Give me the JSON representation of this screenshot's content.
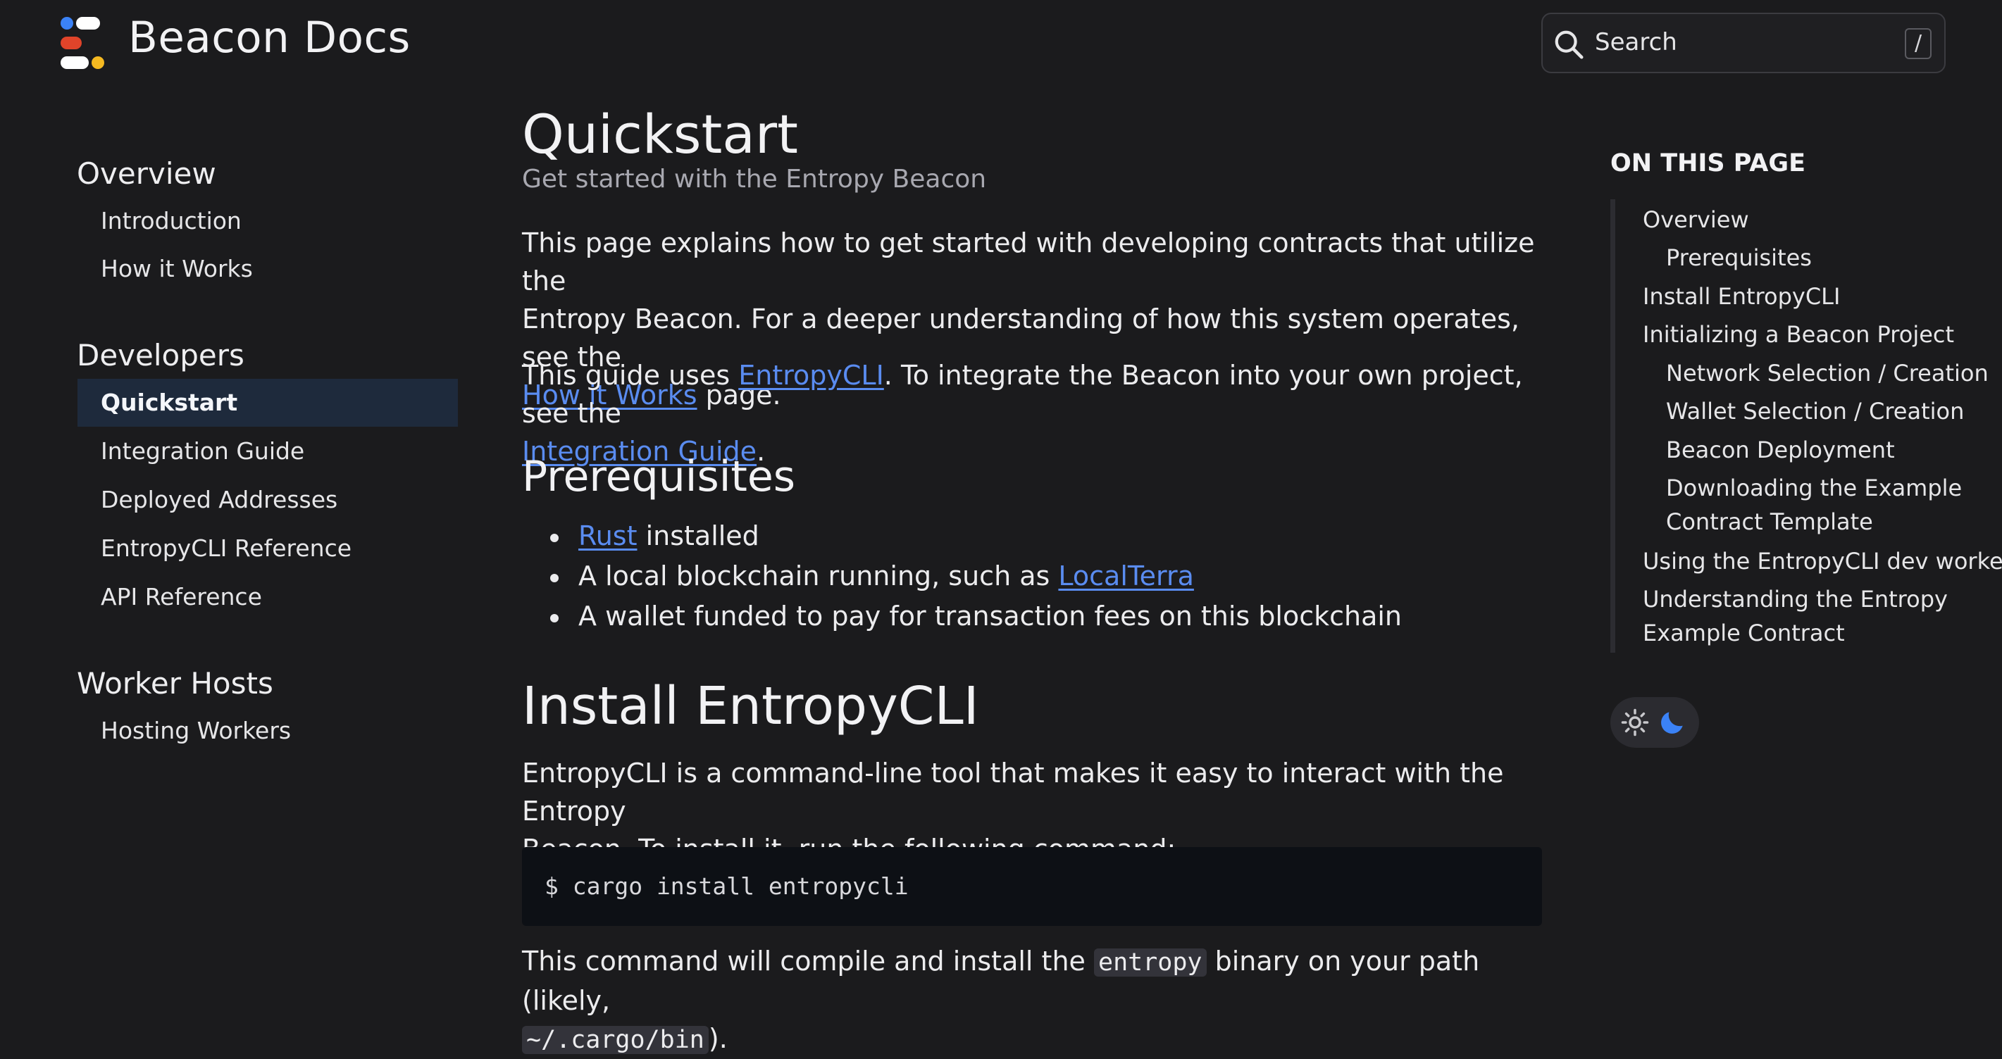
{
  "header": {
    "brand": "Beacon Docs",
    "search_placeholder": "Search",
    "search_shortcut": "/"
  },
  "colors": {
    "background": "#1b1b1d",
    "link": "#5a8cf0",
    "active_bg": "#1e2a3c",
    "logo_blue": "#3b82f6",
    "logo_red": "#e0442a",
    "logo_yellow": "#f5b921",
    "logo_white": "#ffffff"
  },
  "sidebar": {
    "sections": [
      {
        "title": "Overview",
        "items": [
          "Introduction",
          "How it Works"
        ]
      },
      {
        "title": "Developers",
        "items": [
          "Quickstart",
          "Integration Guide",
          "Deployed Addresses",
          "EntropyCLI Reference",
          "API Reference"
        ]
      },
      {
        "title": "Worker Hosts",
        "items": [
          "Hosting Workers"
        ]
      }
    ],
    "active_item": "Quickstart"
  },
  "main": {
    "title": "Quickstart",
    "subtitle": "Get started with the Entropy Beacon",
    "intro": {
      "line1": "This page explains how to get started with developing contracts that utilize the",
      "line2": "Entropy Beacon. For a deeper understanding of how this system operates, see the",
      "link": "How it Works",
      "after": " page."
    },
    "guide": {
      "before": "This guide uses ",
      "link1": "EntropyCLI",
      "middle": ". To integrate the Beacon into your own project, see the",
      "link2": "Integration Guide",
      "after": "."
    },
    "prerequisites": {
      "heading": "Prerequisites",
      "b1_link": "Rust",
      "b1_text": " installed",
      "b2_text": "A local blockchain running, such as ",
      "b2_link": "LocalTerra",
      "b3_text": "A wallet funded to pay for transaction fees on this blockchain"
    },
    "install": {
      "heading": "Install EntropyCLI",
      "line1": "EntropyCLI is a command-line tool that makes it easy to interact with the Entropy",
      "line2": "Beacon. To install it, run the following command:",
      "command": "$ cargo install entropycli",
      "after1": "This command will compile and install the ",
      "binary": "entropy",
      "after2": " binary on your path (likely,",
      "path": "~/.cargo/bin",
      "after3": ")."
    }
  },
  "toc": {
    "title": "ON THIS PAGE",
    "items": [
      "Overview",
      "Prerequisites",
      "Install EntropyCLI",
      "Initializing a Beacon Project",
      "Network Selection / Creation",
      "Wallet Selection / Creation",
      "Beacon Deployment",
      "Downloading the Example",
      "Contract Template",
      "Using the EntropyCLI dev worker",
      "Understanding the Entropy",
      "Example Contract"
    ]
  },
  "theme_toggle": {
    "light_icon": "sun-icon",
    "dark_icon": "moon-icon",
    "active": "dark"
  }
}
